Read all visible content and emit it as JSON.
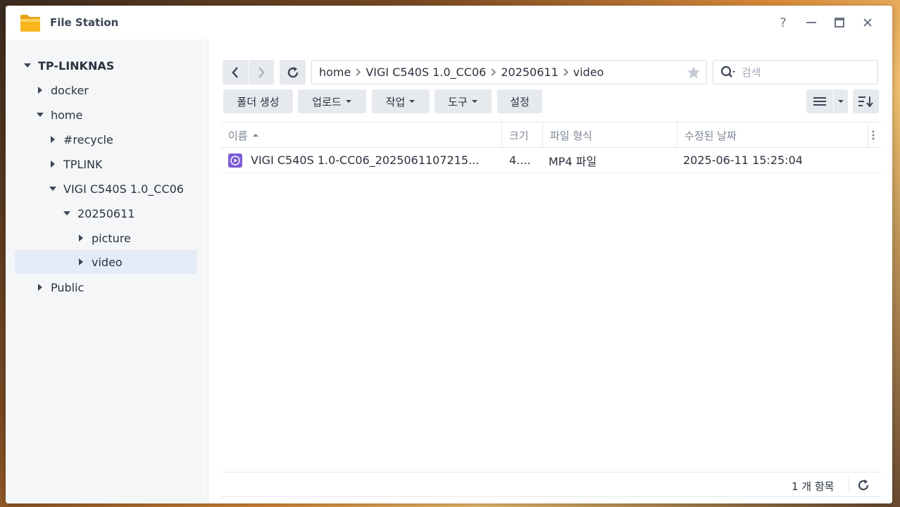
{
  "window": {
    "title": "File Station"
  },
  "sidebar": {
    "root": "TP-LINKNAS",
    "items": [
      {
        "label": "docker"
      },
      {
        "label": "home"
      },
      {
        "label": "#recycle"
      },
      {
        "label": "TPLINK"
      },
      {
        "label": "VIGI C540S 1.0_CC06"
      },
      {
        "label": "20250611"
      },
      {
        "label": "picture"
      },
      {
        "label": "video"
      },
      {
        "label": "Public"
      }
    ]
  },
  "breadcrumb": [
    "home",
    "VIGI C540S 1.0_CC06",
    "20250611",
    "video"
  ],
  "search": {
    "placeholder": "검색"
  },
  "toolbar": {
    "create_folder": "폴더 생성",
    "upload": "업로드",
    "action": "작업",
    "tools": "도구",
    "settings": "설정"
  },
  "table": {
    "headers": {
      "name": "이름",
      "size": "크기",
      "type": "파일 형식",
      "modified": "수정된 날짜"
    },
    "rows": [
      {
        "name": "VIGI C540S 1.0-CC06_2025061107215...",
        "size": "4....",
        "type": "MP4 파일",
        "modified": "2025-06-11 15:25:04"
      }
    ]
  },
  "footer": {
    "count": "1 개 항목"
  },
  "colors": {
    "accent": "#4a7fd6",
    "selected": "#e3ebf7",
    "video_icon": "#7b5cd6"
  }
}
